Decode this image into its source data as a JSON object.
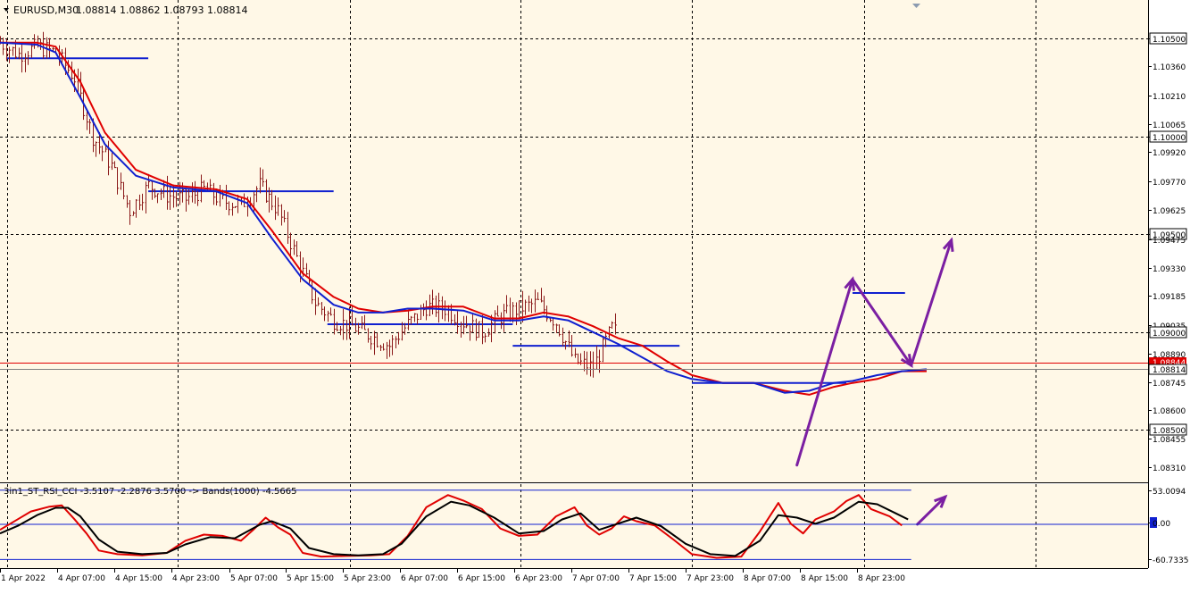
{
  "header": {
    "symbol": "EURUSD,M30",
    "ohlc": "1.08814 1.08862 1.08793 1.08814"
  },
  "indicator_header": "3in1_ST_RSI_CCI -3.5107 -2.2876 3.5700   -> Bands(1000) -4.5665",
  "colors": {
    "background": "#fff8e7",
    "candle": "#8b1a1a",
    "fast_ma": "#e00000",
    "slow_ma": "#1020d0",
    "level_line": "#1020d0",
    "arrow": "#7b1fa2",
    "grid": "#000000",
    "price_line": "#e00000",
    "bid_line": "#808080"
  },
  "chart_data": [
    {
      "type": "candlestick",
      "title": "EURUSD,M30",
      "ylim": [
        1.0825,
        1.1068
      ],
      "y_ticks": [
        "1.10500",
        "1.10360",
        "1.10210",
        "1.10065",
        "1.10000",
        "1.09920",
        "1.09770",
        "1.09625",
        "1.09500",
        "1.09475",
        "1.09330",
        "1.09185",
        "1.09035",
        "1.09000",
        "1.08890",
        "1.08745",
        "1.08600",
        "1.08500",
        "1.08455",
        "1.08310"
      ],
      "y_tick_values": [
        1.105,
        1.1036,
        1.1021,
        1.10065,
        1.1,
        1.0992,
        1.0977,
        1.09625,
        1.095,
        1.09475,
        1.0933,
        1.09185,
        1.09035,
        1.09,
        1.0889,
        1.08745,
        1.086,
        1.085,
        1.08455,
        1.0831
      ],
      "highlighted_ticks": [
        "1.10500",
        "1.10000",
        "1.09500",
        "1.09000",
        "1.08500"
      ],
      "current_price": "1.08814",
      "price_tag_top": "1.08844",
      "x_ticks": [
        "1 Apr 2022",
        "4 Apr 07:00",
        "4 Apr 15:00",
        "4 Apr 23:00",
        "5 Apr 07:00",
        "5 Apr 15:00",
        "5 Apr 23:00",
        "6 Apr 07:00",
        "6 Apr 15:00",
        "6 Apr 23:00",
        "7 Apr 07:00",
        "7 Apr 15:00",
        "7 Apr 23:00",
        "8 Apr 07:00",
        "8 Apr 15:00",
        "8 Apr 23:00"
      ],
      "bar_count": 200,
      "close_path": [
        [
          0,
          1.1048
        ],
        [
          6,
          1.1042
        ],
        [
          12,
          1.1046
        ],
        [
          18,
          1.1043
        ],
        [
          24,
          1.103
        ],
        [
          30,
          1.1
        ],
        [
          36,
          1.0985
        ],
        [
          42,
          1.0962
        ],
        [
          48,
          1.0975
        ],
        [
          54,
          1.097
        ],
        [
          60,
          1.0968
        ],
        [
          66,
          1.0973
        ],
        [
          72,
          1.0967
        ],
        [
          78,
          1.0965
        ],
        [
          84,
          1.0975
        ],
        [
          90,
          1.0962
        ],
        [
          96,
          1.0938
        ],
        [
          102,
          1.0915
        ],
        [
          108,
          1.0906
        ],
        [
          114,
          1.0903
        ],
        [
          120,
          1.0898
        ],
        [
          126,
          1.0893
        ],
        [
          132,
          1.0904
        ],
        [
          138,
          1.0913
        ],
        [
          144,
          1.0912
        ],
        [
          150,
          1.0905
        ],
        [
          156,
          1.09
        ],
        [
          162,
          1.0908
        ],
        [
          168,
          1.0912
        ],
        [
          174,
          1.0915
        ],
        [
          180,
          1.0905
        ],
        [
          186,
          1.0885
        ],
        [
          192,
          1.0882
        ],
        [
          198,
          1.0902
        ],
        [
          204,
          1.0893
        ],
        [
          210,
          1.088
        ],
        [
          216,
          1.0873
        ],
        [
          222,
          1.0866
        ],
        [
          228,
          1.086
        ],
        [
          234,
          1.0857
        ],
        [
          240,
          1.087
        ],
        [
          246,
          1.0875
        ],
        [
          252,
          1.0866
        ],
        [
          256,
          1.0846
        ],
        [
          260,
          1.0868
        ],
        [
          266,
          1.0874
        ],
        [
          272,
          1.0878
        ],
        [
          276,
          1.0928
        ],
        [
          280,
          1.0915
        ],
        [
          286,
          1.0893
        ],
        [
          292,
          1.0886
        ],
        [
          297,
          1.0882
        ]
      ],
      "ma_fast_path": [
        [
          0,
          1.1048
        ],
        [
          12,
          1.1048
        ],
        [
          18,
          1.1046
        ],
        [
          26,
          1.1028
        ],
        [
          34,
          1.1002
        ],
        [
          44,
          1.0983
        ],
        [
          56,
          1.0975
        ],
        [
          70,
          1.0973
        ],
        [
          80,
          1.0968
        ],
        [
          88,
          1.0952
        ],
        [
          98,
          1.093
        ],
        [
          108,
          1.0918
        ],
        [
          116,
          1.0912
        ],
        [
          124,
          1.091
        ],
        [
          132,
          1.0911
        ],
        [
          140,
          1.0913
        ],
        [
          150,
          1.0913
        ],
        [
          160,
          1.0907
        ],
        [
          168,
          1.0907
        ],
        [
          176,
          1.091
        ],
        [
          184,
          1.0908
        ],
        [
          192,
          1.0903
        ],
        [
          200,
          1.0897
        ],
        [
          208,
          1.0893
        ],
        [
          216,
          1.0885
        ],
        [
          224,
          1.0878
        ],
        [
          234,
          1.0874
        ],
        [
          244,
          1.0874
        ],
        [
          254,
          1.087
        ],
        [
          262,
          1.0868
        ],
        [
          270,
          1.0872
        ],
        [
          276,
          1.0874
        ],
        [
          284,
          1.0876
        ],
        [
          292,
          1.088
        ],
        [
          300,
          1.088
        ]
      ],
      "ma_slow_path": [
        [
          0,
          1.1048
        ],
        [
          12,
          1.1047
        ],
        [
          18,
          1.1043
        ],
        [
          26,
          1.102
        ],
        [
          34,
          1.0996
        ],
        [
          44,
          1.098
        ],
        [
          56,
          1.0974
        ],
        [
          70,
          1.0972
        ],
        [
          80,
          1.0966
        ],
        [
          88,
          1.0948
        ],
        [
          98,
          1.0927
        ],
        [
          108,
          1.0914
        ],
        [
          116,
          1.091
        ],
        [
          124,
          1.091
        ],
        [
          132,
          1.0912
        ],
        [
          140,
          1.0912
        ],
        [
          150,
          1.0911
        ],
        [
          160,
          1.0906
        ],
        [
          168,
          1.0906
        ],
        [
          176,
          1.0908
        ],
        [
          184,
          1.0906
        ],
        [
          192,
          1.09
        ],
        [
          200,
          1.0894
        ],
        [
          208,
          1.0887
        ],
        [
          216,
          1.088
        ],
        [
          224,
          1.0876
        ],
        [
          234,
          1.0874
        ],
        [
          244,
          1.0874
        ],
        [
          254,
          1.0869
        ],
        [
          262,
          1.087
        ],
        [
          270,
          1.0874
        ],
        [
          276,
          1.0875
        ],
        [
          284,
          1.0878
        ],
        [
          292,
          1.088
        ],
        [
          300,
          1.0881
        ]
      ],
      "level_lines": [
        {
          "price": 1.104,
          "from_bar": 2,
          "to_bar": 48
        },
        {
          "price": 1.0972,
          "from_bar": 48,
          "to_bar": 108
        },
        {
          "price": 1.0904,
          "from_bar": 106,
          "to_bar": 166
        },
        {
          "price": 1.0893,
          "from_bar": 166,
          "to_bar": 220
        },
        {
          "price": 1.0874,
          "from_bar": 224,
          "to_bar": 274
        },
        {
          "price": 1.092,
          "from_bar": 276,
          "to_bar": 293
        }
      ],
      "arrows": [
        {
          "from": [
            258,
            1.0832
          ],
          "to": [
            276,
            1.0927
          ]
        },
        {
          "from": [
            276,
            1.0927
          ],
          "to": [
            295,
            1.0883
          ]
        },
        {
          "from": [
            295,
            1.0883
          ],
          "to": [
            308,
            1.0947
          ]
        }
      ]
    },
    {
      "type": "line",
      "title": "3in1_ST_RSI_CCI",
      "ylim": [
        -72,
        60
      ],
      "y_ticks": [
        "53.0094",
        "0.00",
        "-60.7335"
      ],
      "y_tick_values": [
        53.0094,
        0,
        -60.7335
      ],
      "bands": [
        53.0094,
        -3.0,
        -60.7335
      ],
      "series": [
        {
          "name": "fast",
          "color": "#e00000",
          "points": [
            [
              0,
              -12
            ],
            [
              6,
              6
            ],
            [
              10,
              18
            ],
            [
              16,
              26
            ],
            [
              20,
              28
            ],
            [
              24,
              6
            ],
            [
              28,
              -18
            ],
            [
              32,
              -46
            ],
            [
              38,
              -52
            ],
            [
              46,
              -54
            ],
            [
              54,
              -50
            ],
            [
              60,
              -30
            ],
            [
              66,
              -20
            ],
            [
              72,
              -22
            ],
            [
              78,
              -30
            ],
            [
              82,
              -12
            ],
            [
              86,
              8
            ],
            [
              90,
              -8
            ],
            [
              94,
              -20
            ],
            [
              98,
              -50
            ],
            [
              104,
              -56
            ],
            [
              112,
              -55
            ],
            [
              120,
              -54
            ],
            [
              126,
              -52
            ],
            [
              132,
              -22
            ],
            [
              138,
              25
            ],
            [
              145,
              45
            ],
            [
              150,
              36
            ],
            [
              156,
              22
            ],
            [
              162,
              -10
            ],
            [
              168,
              -22
            ],
            [
              174,
              -20
            ],
            [
              180,
              10
            ],
            [
              186,
              25
            ],
            [
              190,
              -5
            ],
            [
              194,
              -20
            ],
            [
              198,
              -10
            ],
            [
              202,
              10
            ],
            [
              206,
              2
            ],
            [
              212,
              -5
            ],
            [
              218,
              -28
            ],
            [
              224,
              -52
            ],
            [
              232,
              -58
            ],
            [
              240,
              -56
            ],
            [
              246,
              -15
            ],
            [
              252,
              32
            ],
            [
              256,
              -2
            ],
            [
              260,
              -18
            ],
            [
              264,
              5
            ],
            [
              270,
              18
            ],
            [
              274,
              35
            ],
            [
              278,
              45
            ],
            [
              282,
              22
            ],
            [
              288,
              10
            ],
            [
              292,
              -5
            ]
          ]
        },
        {
          "name": "slow",
          "color": "#000000",
          "points": [
            [
              0,
              -18
            ],
            [
              6,
              -5
            ],
            [
              12,
              12
            ],
            [
              18,
              24
            ],
            [
              22,
              24
            ],
            [
              26,
              10
            ],
            [
              32,
              -28
            ],
            [
              38,
              -48
            ],
            [
              46,
              -52
            ],
            [
              54,
              -50
            ],
            [
              60,
              -36
            ],
            [
              68,
              -24
            ],
            [
              76,
              -26
            ],
            [
              84,
              -4
            ],
            [
              88,
              2
            ],
            [
              94,
              -10
            ],
            [
              100,
              -42
            ],
            [
              108,
              -52
            ],
            [
              116,
              -54
            ],
            [
              124,
              -52
            ],
            [
              130,
              -35
            ],
            [
              138,
              10
            ],
            [
              146,
              34
            ],
            [
              152,
              28
            ],
            [
              160,
              8
            ],
            [
              168,
              -18
            ],
            [
              176,
              -14
            ],
            [
              182,
              5
            ],
            [
              188,
              15
            ],
            [
              194,
              -12
            ],
            [
              200,
              -2
            ],
            [
              206,
              8
            ],
            [
              214,
              -6
            ],
            [
              222,
              -35
            ],
            [
              230,
              -52
            ],
            [
              238,
              -55
            ],
            [
              246,
              -30
            ],
            [
              252,
              12
            ],
            [
              258,
              8
            ],
            [
              264,
              -2
            ],
            [
              270,
              8
            ],
            [
              278,
              34
            ],
            [
              284,
              30
            ],
            [
              290,
              15
            ],
            [
              294,
              5
            ]
          ]
        }
      ],
      "arrows": [
        {
          "from": [
            297,
            -3
          ],
          "to": [
            306,
            42
          ]
        }
      ]
    }
  ]
}
